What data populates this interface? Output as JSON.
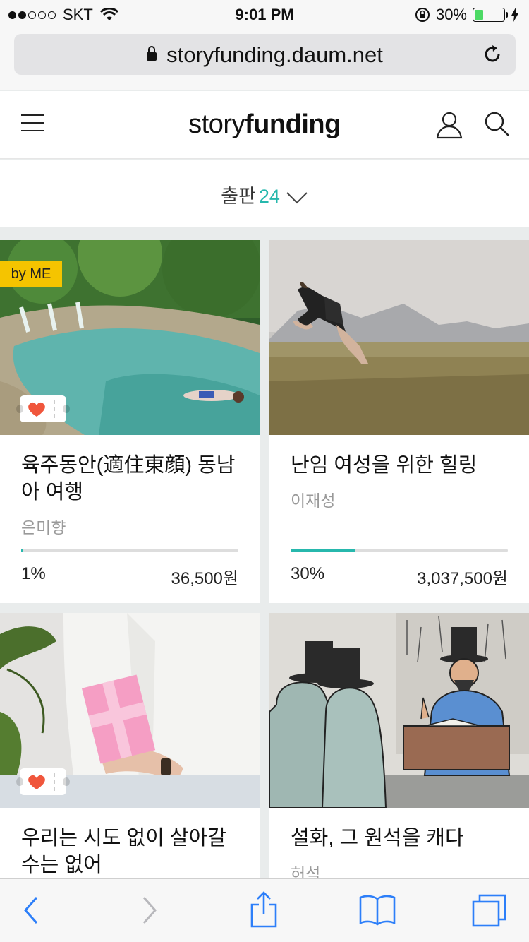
{
  "status_bar": {
    "carrier": "SKT",
    "time": "9:01 PM",
    "battery": "30%",
    "battery_level": 0.3
  },
  "browser": {
    "url": "storyfunding.daum.net"
  },
  "site": {
    "logo_light": "story",
    "logo_bold": "funding"
  },
  "category": {
    "label": "출판",
    "count": "24"
  },
  "cards": [
    {
      "title": "육주동안(適住東顔) 동남아 여행",
      "author": "은미향",
      "percent_label": "1%",
      "progress": 0.01,
      "amount": "36,500원",
      "badge": "by ME"
    },
    {
      "title": "난임 여성을 위한 힐링",
      "author": "이재성",
      "percent_label": "30%",
      "progress": 0.3,
      "amount": "3,037,500원"
    },
    {
      "title": "우리는 시도 없이 살아갈 수는 없어"
    },
    {
      "title": "설화, 그 원석을 캐다",
      "author": "허석"
    }
  ],
  "colors": {
    "accent": "#27b8ad",
    "badge": "#f5c400",
    "ios_blue": "#2d7ff9"
  },
  "icons": [
    "menu-icon",
    "user-icon",
    "search-icon",
    "chevron-down-icon",
    "lock-icon",
    "reload-icon",
    "back-icon",
    "forward-icon",
    "share-icon",
    "bookmarks-icon",
    "tabs-icon",
    "ticket-heart-icon"
  ]
}
